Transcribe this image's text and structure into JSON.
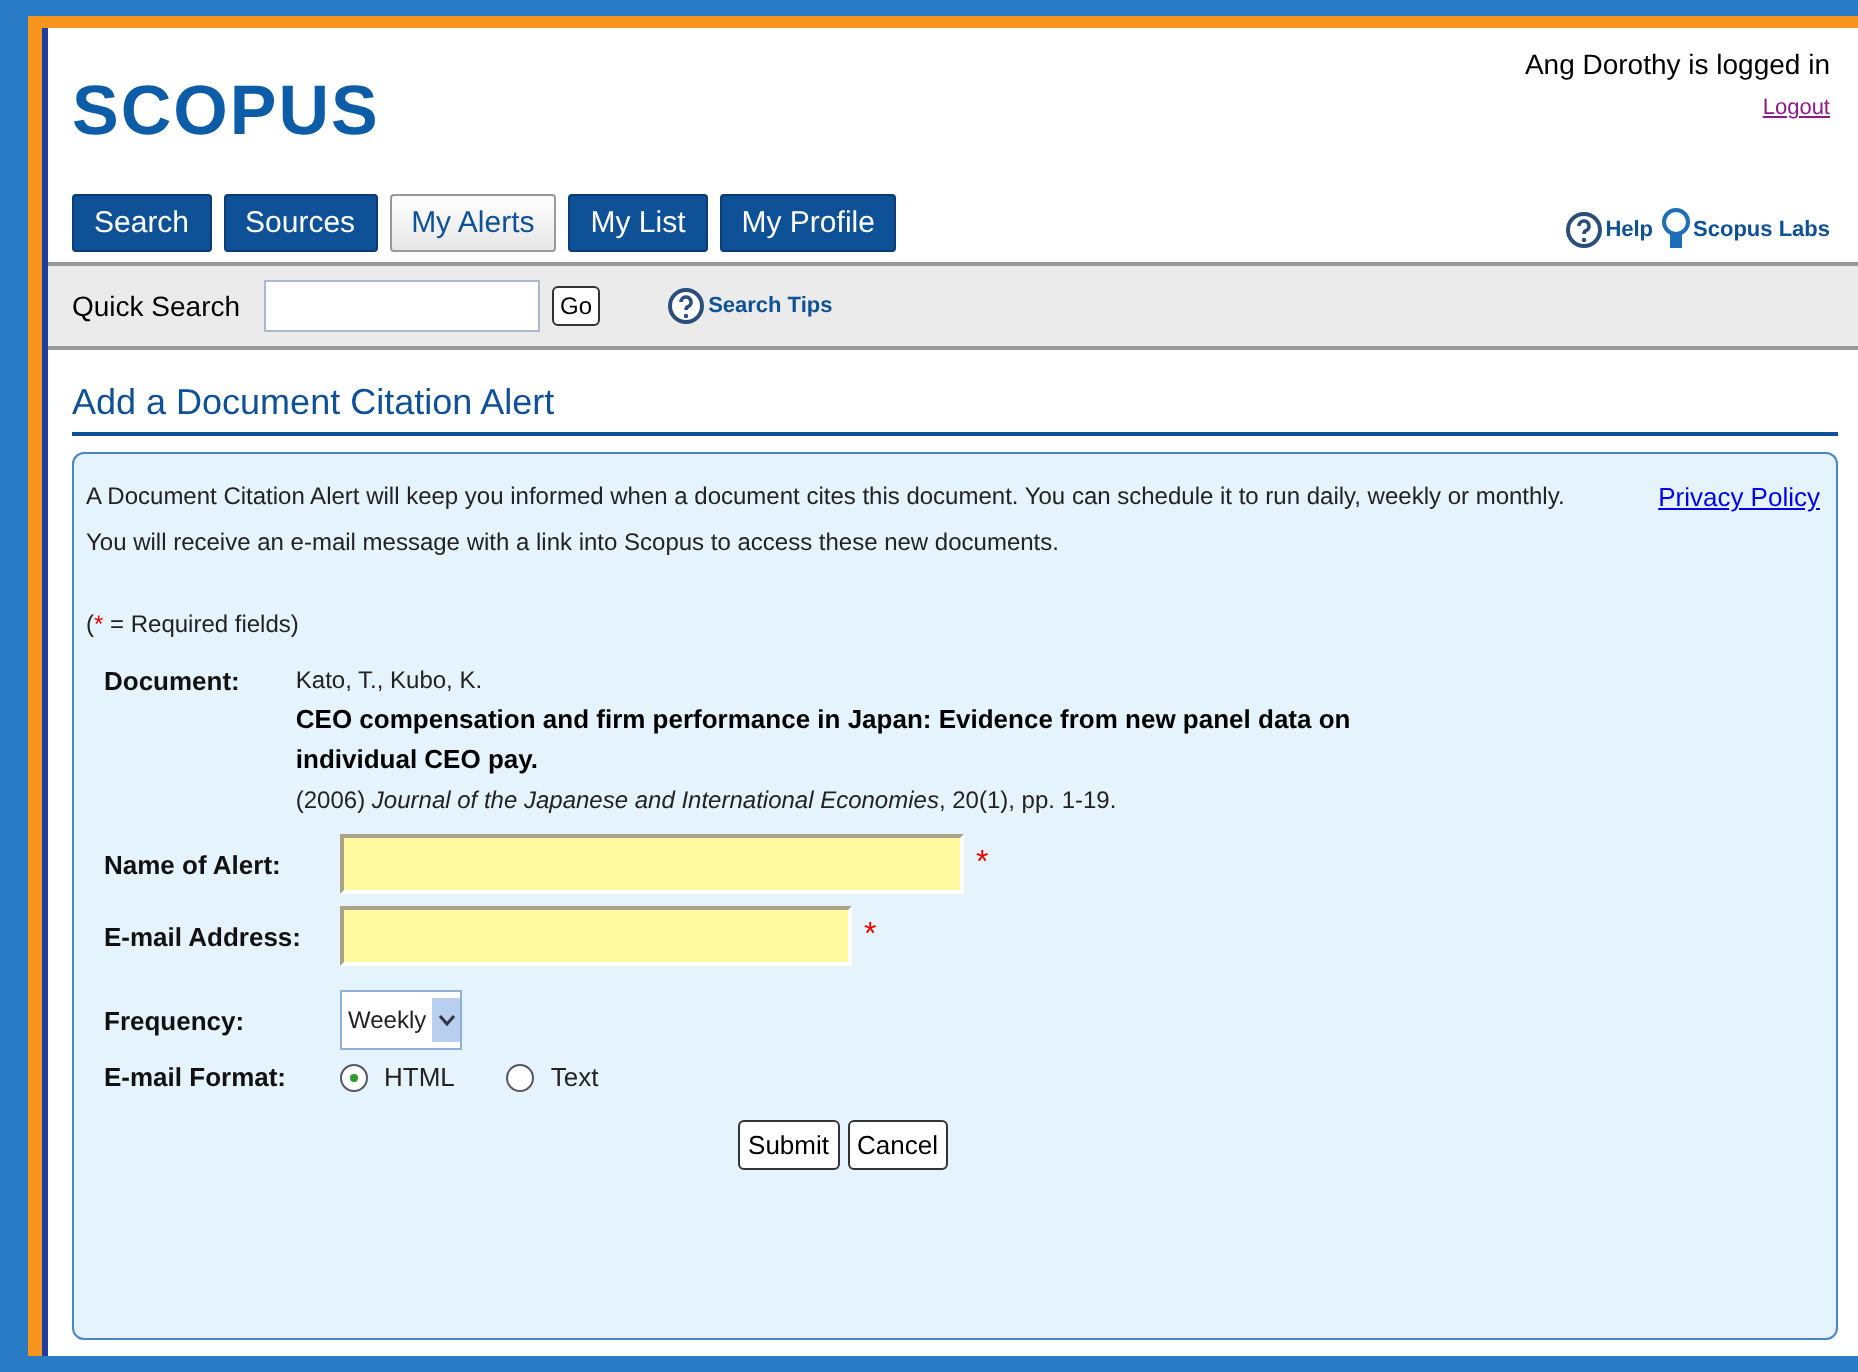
{
  "user": {
    "status": "Ang Dorothy is logged in",
    "logout": "Logout"
  },
  "logo": "SCOPUS",
  "tabs": [
    {
      "label": "Search",
      "selected": false
    },
    {
      "label": "Sources",
      "selected": false
    },
    {
      "label": "My Alerts",
      "selected": true
    },
    {
      "label": "My List",
      "selected": false
    },
    {
      "label": "My Profile",
      "selected": false
    }
  ],
  "help_links": [
    {
      "kind": "help",
      "label": "Help"
    },
    {
      "kind": "labs",
      "label": "Scopus Labs"
    }
  ],
  "quick_search": {
    "label": "Quick Search",
    "button": "Go",
    "tips": "Search Tips"
  },
  "page_title": "Add a Document Citation Alert",
  "intro": "A Document Citation Alert will keep you informed when a document cites this document. You can schedule it to run daily, weekly or monthly. You will receive an e-mail message with a link into Scopus to access these new documents.",
  "privacy_link": "Privacy Policy",
  "required_note": {
    "open": "(",
    "mark": "*",
    "rest": " = Required fields)"
  },
  "document": {
    "label": "Document:",
    "authors": "Kato, T., Kubo, K.",
    "title": "CEO compensation and firm performance in Japan: Evidence from new panel data on individual CEO pay.",
    "source": "(2006) *Journal of the Japanese and International Economies*, 20(1), pp. 1-19."
  },
  "fields": [
    {
      "label": "Name of Alert:",
      "mark": "*"
    },
    {
      "label": "E-mail Address:",
      "mark": "*"
    }
  ],
  "frequency": {
    "label": "Frequency:",
    "value": "Weekly"
  },
  "format": {
    "label": "E-mail Format:",
    "options": [
      {
        "label": "HTML",
        "selected": true
      },
      {
        "label": "Text",
        "selected": false
      }
    ]
  },
  "buttons": [
    "Submit",
    "Cancel"
  ]
}
